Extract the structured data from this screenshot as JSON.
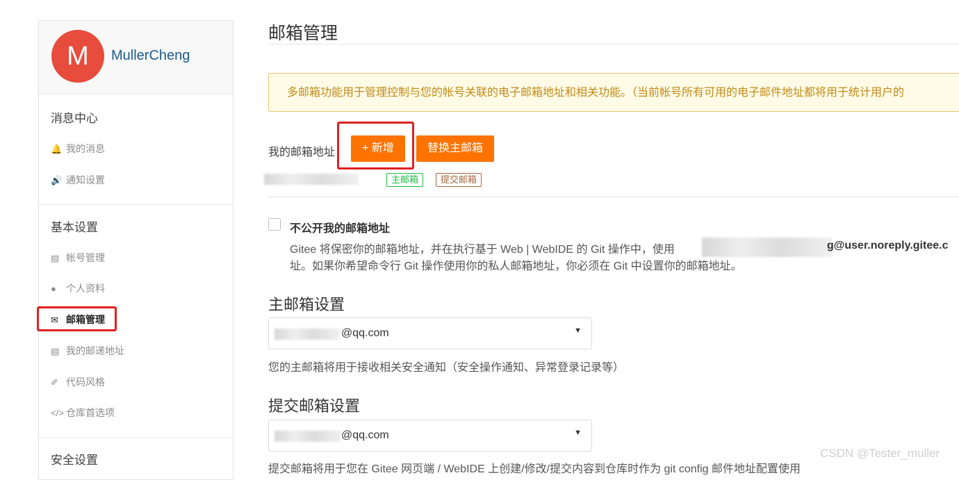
{
  "sidebar": {
    "avatar_letter": "M",
    "username": "MullerCheng",
    "groups": {
      "messages": "消息中心",
      "basic": "基本设置",
      "security": "安全设置"
    },
    "items": {
      "my_messages": "我的消息",
      "notify_settings": "通知设置",
      "account": "帐号管理",
      "profile": "个人资料",
      "email": "邮箱管理",
      "address": "我的邮递地址",
      "code_style": "代码风格",
      "repo_prefs": "仓库首选项"
    }
  },
  "main": {
    "title": "邮箱管理",
    "notice": "多邮箱功能用于管理控制与您的帐号关联的电子邮箱地址和相关功能。（当前帐号所有可用的电子邮件地址都将用于统计用户的",
    "my_email_label": "我的邮箱地址",
    "add_button": "+ 新增",
    "switch_button": "替换主邮箱",
    "tag_primary": "主邮箱",
    "tag_commit": "提交邮箱",
    "private_label": "不公开我的邮箱地址",
    "private_desc_1_a": "Gitee 将保密你的邮箱地址，并在执行基于 Web | WebIDE 的 Git 操作中，使用",
    "private_desc_1_b": "g@user.noreply.gitee.c",
    "private_desc_2": "址。如果你希望命令行 Git 操作使用你的私人邮箱地址，你必须在 Git 中设置你的邮箱地址。",
    "primary_title": "主邮箱设置",
    "primary_value": "@qq.com",
    "primary_hint": "您的主邮箱将用于接收相关安全通知（安全操作通知、异常登录记录等）",
    "commit_title": "提交邮箱设置",
    "commit_value": "@qq.com",
    "commit_hint": "提交邮箱将用于您在 Gitee 网页端 / WebIDE 上创建/修改/提交内容到仓库时作为 git config 邮件地址配置使用"
  },
  "watermark": "CSDN @Tester_muller",
  "colors": {
    "accent": "#fe7300",
    "highlight_box": "#e02020",
    "notice_bg": "#fffbe6",
    "notice_text": "#c28a1a"
  }
}
